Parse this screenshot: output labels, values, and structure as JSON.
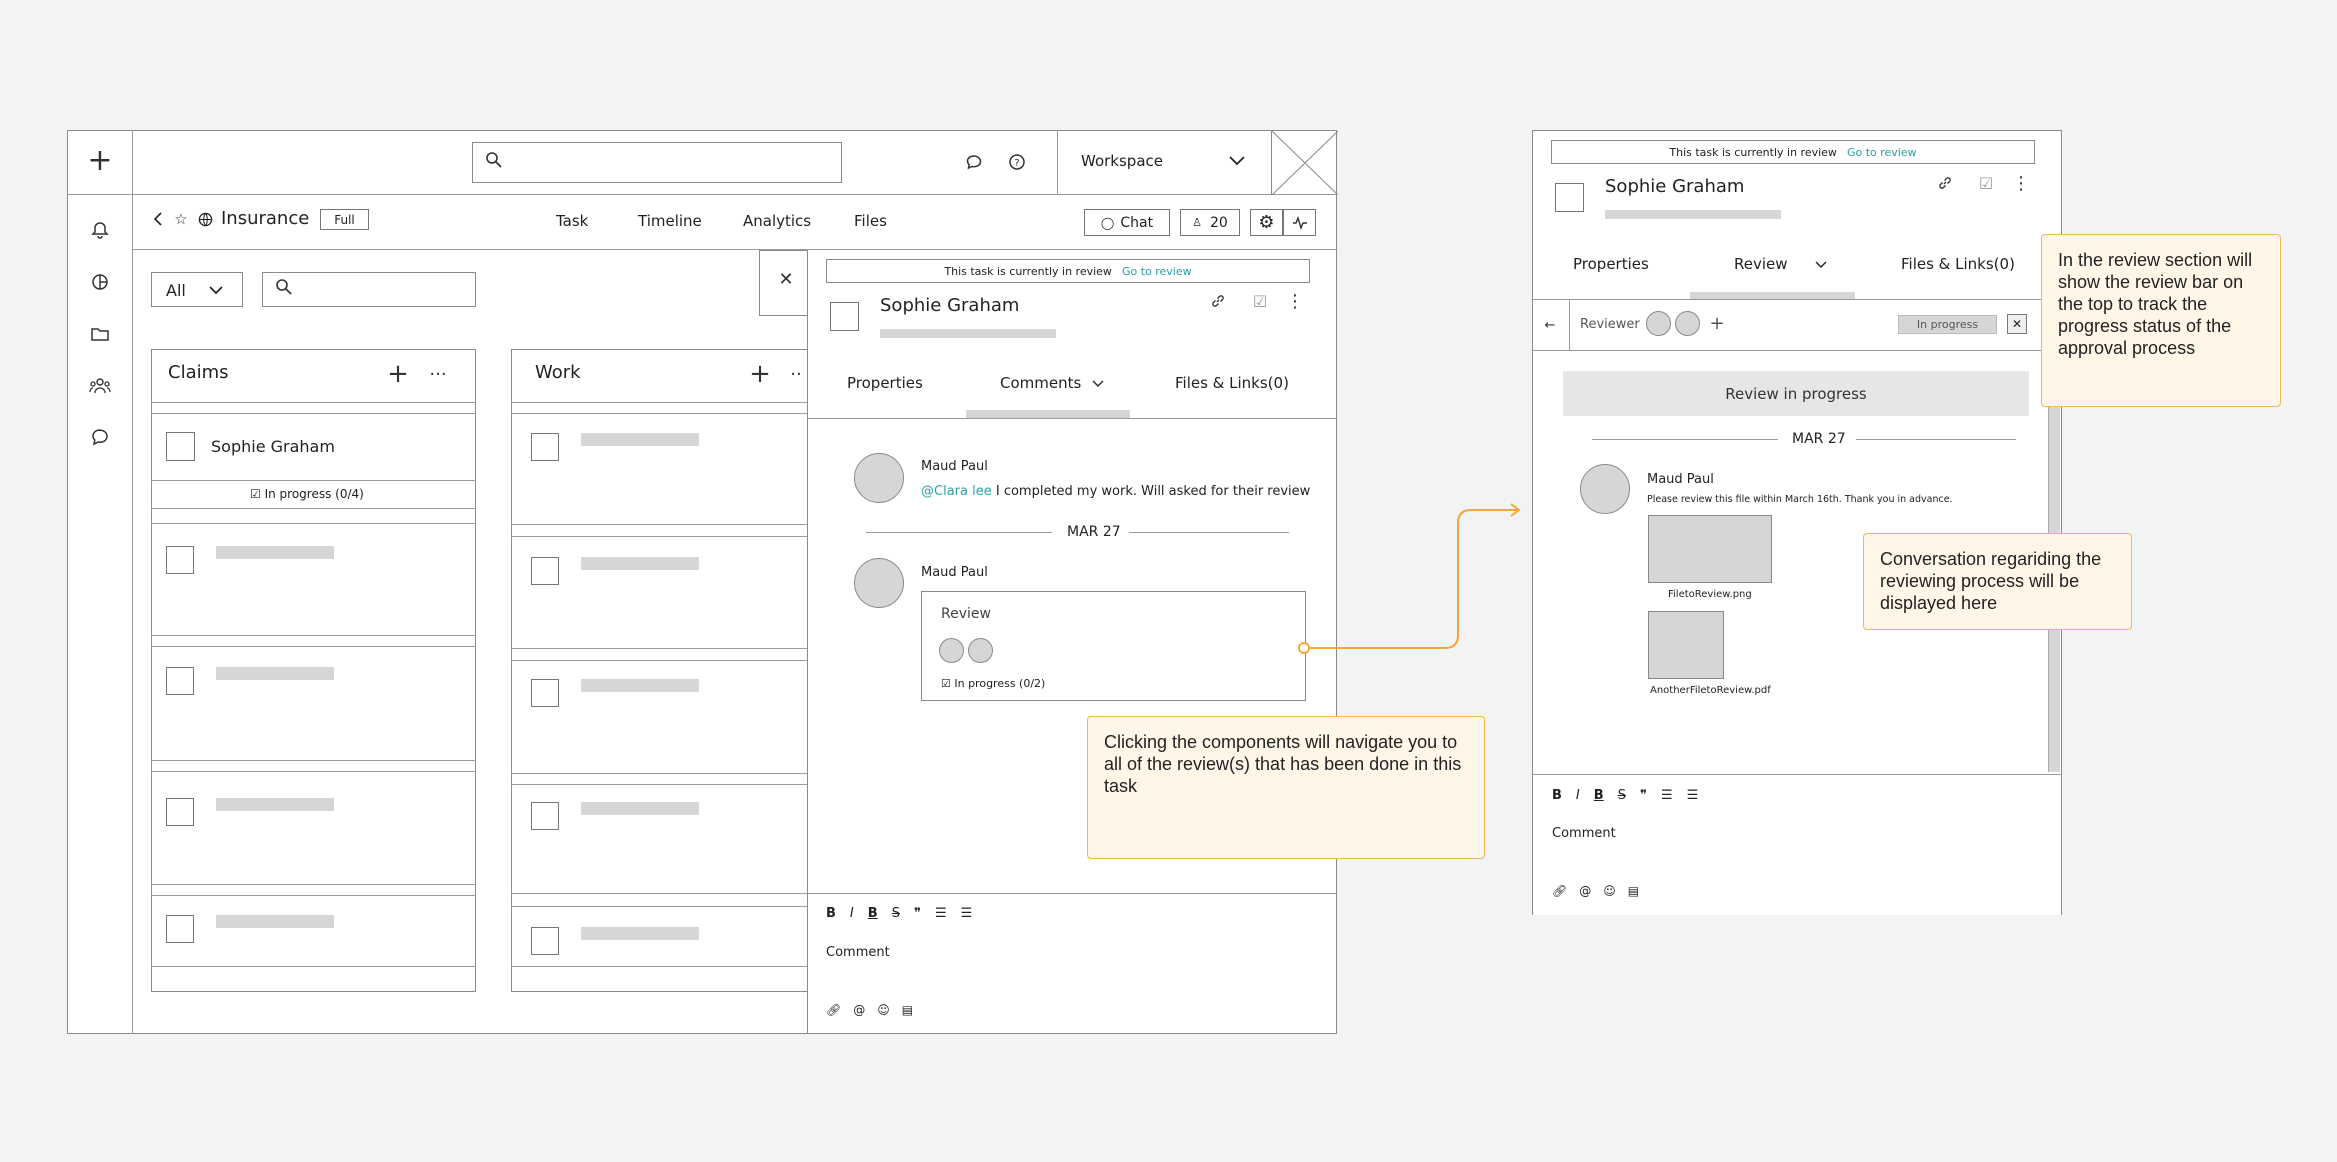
{
  "left_sidebar": {
    "add_label": "+"
  },
  "header": {
    "workspace_label": "Workspace"
  },
  "project_bar": {
    "project_name": "Insurance",
    "badge": "Full",
    "tabs": [
      "Task",
      "Timeline",
      "Analytics",
      "Files"
    ],
    "chat_label": "Chat",
    "member_count": "20"
  },
  "filter": {
    "selected": "All"
  },
  "columns": [
    {
      "title": "Claims",
      "first_card_title": "Sophie Graham",
      "first_card_status": "In progress (0/4)"
    },
    {
      "title": "Work"
    }
  ],
  "task_panel": {
    "review_banner": "This task is currently in review",
    "review_link": "Go to review",
    "title": "Sophie Graham",
    "tabs": {
      "properties": "Properties",
      "comments": "Comments",
      "files": "Files & Links(0)"
    },
    "comment1_author": "Maud Paul",
    "comment1_mention": "@Clara lee",
    "comment1_text": " I completed my work. Will asked for their review",
    "date_divider": "MAR 27",
    "comment2_author": "Maud Paul",
    "review_card_title": "Review",
    "review_card_status": "In progress (0/2)",
    "editor_placeholder": "Comment",
    "toolbar": {
      "bold": "B",
      "italic": "I",
      "bold2": "B",
      "strike": "S",
      "quote": "❞"
    }
  },
  "review_panel": {
    "review_banner": "This task is currently in review",
    "review_link": "Go to review",
    "title": "Sophie Graham",
    "tabs": {
      "properties": "Properties",
      "review": "Review",
      "files": "Files & Links(0)"
    },
    "reviewer_label": "Reviewer",
    "status_pill": "In progress",
    "review_bar": "Review in progress",
    "date_divider": "MAR 27",
    "comment_author": "Maud Paul",
    "comment_text": "Please review this file within March 16th. Thank you in advance.",
    "file1": "FiletoReview.png",
    "file2": "AnotherFiletoReview.pdf",
    "editor_placeholder": "Comment",
    "toolbar": {
      "bold": "B",
      "italic": "I",
      "bold2": "B",
      "strike": "S",
      "quote": "❞"
    }
  },
  "notes": {
    "navigate": "Clicking the components will navigate you to\nall of the review(s) that has been done in this task",
    "review_section": "In the review  section will show the review bar on the top to track the progress status of the approval process",
    "conversation": "Conversation regariding the reviewing process will be displayed here"
  },
  "colors": {
    "accent_link": "#2aa0a8",
    "note_bg": "#fff6e8",
    "note_border": "#f3b65a",
    "connector": "#f5a53c"
  }
}
